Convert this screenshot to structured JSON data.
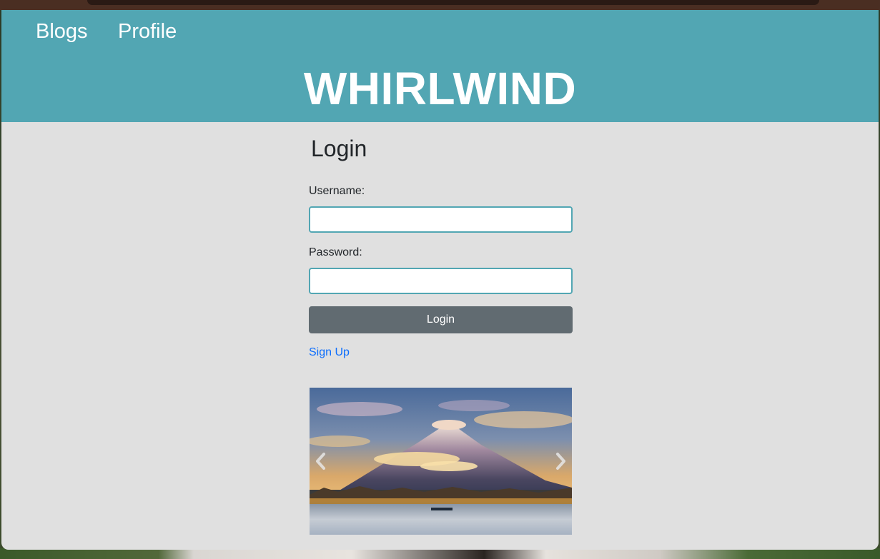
{
  "nav": {
    "blogs": "Blogs",
    "profile": "Profile"
  },
  "site": {
    "title": "WHIRLWIND"
  },
  "login": {
    "heading": "Login",
    "username_label": "Username:",
    "username_value": "",
    "password_label": "Password:",
    "password_value": "",
    "submit_label": "Login",
    "signup_label": "Sign Up"
  },
  "carousel": {
    "prev_icon": "chevron-left-icon",
    "next_icon": "chevron-right-icon"
  },
  "colors": {
    "header": "#52a6b3",
    "page_background": "#e0e0e0",
    "button": "#616b71",
    "link": "#0d6efd",
    "input_border": "#52a6b3"
  }
}
